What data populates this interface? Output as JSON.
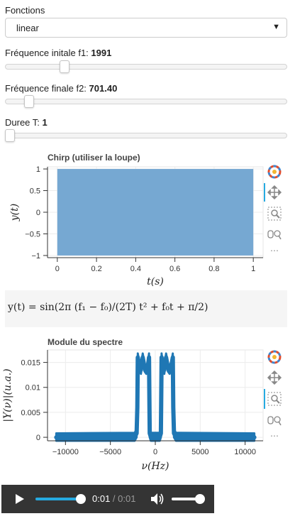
{
  "fonctions": {
    "label": "Fonctions",
    "selected": "linear"
  },
  "slider_f1": {
    "label": "Fréquence initale f1: ",
    "value": "1991",
    "fraction": 0.2
  },
  "slider_f2": {
    "label": "Fréquence finale f2: ",
    "value": "701.40",
    "fraction": 0.07
  },
  "slider_T": {
    "label": "Duree T: ",
    "value": "1",
    "fraction": 0.0
  },
  "chirp_plot": {
    "title": "Chirp (utiliser la loupe)",
    "xlabel": "t(s)",
    "ylabel": "y(t)",
    "x_ticks": [
      "0",
      "0.2",
      "0.4",
      "0.6",
      "0.8",
      "1"
    ],
    "y_ticks": [
      "1",
      "0.5",
      "0",
      "−0.5",
      "−1"
    ]
  },
  "formula": {
    "text": "y(t) = sin(2π (f₁ − f₀)/(2T) t² + f₀t + π/2)"
  },
  "spectrum_plot": {
    "title": "Module du spectre",
    "xlabel": "ν(Hz)",
    "ylabel": "|Y(ν)|(u.a.)",
    "x_ticks": [
      "−10000",
      "−5000",
      "0",
      "5000",
      "10000"
    ],
    "y_ticks": [
      "0.015",
      "0.01",
      "0.005",
      "0"
    ]
  },
  "toolbar_icons": [
    "bokeh-logo-icon",
    "pan-icon",
    "box-zoom-icon",
    "wheel-zoom-icon",
    "hover-icon",
    "more-icon"
  ],
  "audio_player": {
    "current": "0:01",
    "separator": " / ",
    "duration": "0:01",
    "progress": 1.0,
    "volume": 1.0
  },
  "colors": {
    "chirp_fill": "#76a8d2",
    "spectrum_line": "#1f77b4",
    "active_tool": "#26aae1",
    "player_bg": "#343434"
  },
  "chart_data": [
    {
      "type": "area",
      "title": "Chirp (utiliser la loupe)",
      "xlabel": "t(s)",
      "ylabel": "y(t)",
      "xlim": [
        -0.05,
        1.05
      ],
      "ylim": [
        -1.05,
        1.05
      ],
      "x": [
        0,
        1
      ],
      "upper": [
        1,
        1
      ],
      "lower": [
        -1,
        -1
      ],
      "grid": true
    },
    {
      "type": "line",
      "title": "Module du spectre",
      "xlabel": "ν(Hz)",
      "ylabel": "|Y(ν)|(u.a.)",
      "xlim": [
        -12000,
        12000
      ],
      "ylim": [
        -0.0007,
        0.0175
      ],
      "grid": true,
      "series": [
        {
          "x": [
            -11025,
            -2300,
            -2080,
            -2000,
            -1950,
            -1800,
            -1600,
            -1400,
            -1200,
            -1000,
            -800,
            -700,
            -650,
            -620,
            -500,
            500,
            620,
            650,
            700,
            800,
            1000,
            1200,
            1400,
            1600,
            1800,
            1950,
            2000,
            2080,
            2300,
            11025
          ],
          "y": [
            0,
            0.0001,
            0.0008,
            0.006,
            0.016,
            0.0145,
            0.0135,
            0.016,
            0.014,
            0.0135,
            0.0145,
            0.016,
            0.006,
            0.0008,
            0.0001,
            0.0001,
            0.0008,
            0.006,
            0.016,
            0.0145,
            0.0135,
            0.016,
            0.014,
            0.0135,
            0.0145,
            0.016,
            0.006,
            0.0008,
            0.0001,
            0
          ],
          "band": 0.0008
        }
      ]
    }
  ]
}
